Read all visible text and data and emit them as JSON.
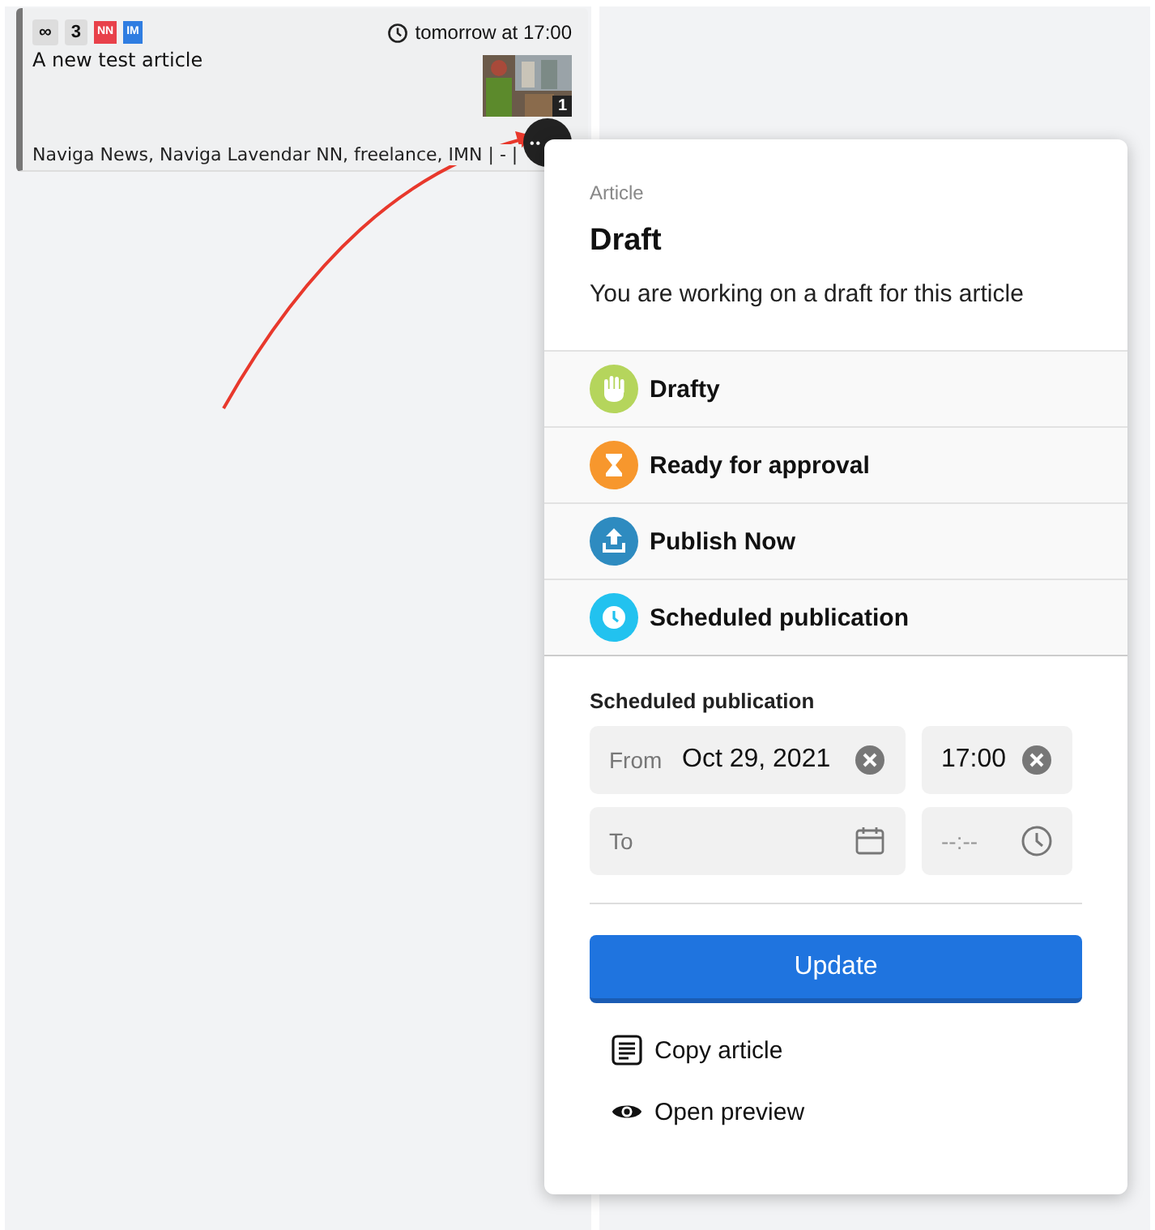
{
  "card": {
    "badges": [
      "∞",
      "3"
    ],
    "tags": [
      {
        "label": "NN",
        "color": "#e8414a"
      },
      {
        "label": "IM",
        "color": "#2f7de1"
      }
    ],
    "time": "tomorrow at 17:00",
    "title": "A new test article",
    "image_count": "1",
    "footer": "Naviga News, Naviga Lavendar NN, freelance, IMN | - |",
    "menu_button": "••"
  },
  "popup": {
    "kicker": "Article",
    "title": "Draft",
    "description": "You are working on a draft for this article",
    "statuses": [
      {
        "kind": "hand",
        "label": "Drafty",
        "color": "#b5d55c"
      },
      {
        "kind": "hourglass",
        "label": "Ready for approval",
        "color": "#f7972d"
      },
      {
        "kind": "upload",
        "label": "Publish Now",
        "color": "#2e8bc0"
      },
      {
        "kind": "clock",
        "label": "Scheduled publication",
        "color": "#22c2ef"
      }
    ],
    "schedule": {
      "heading": "Scheduled publication",
      "from": {
        "label": "From",
        "date": "Oct 29, 2021",
        "time": "17:00"
      },
      "to": {
        "label": "To",
        "time_placeholder": "--:--"
      }
    },
    "update_button": "Update",
    "actions": [
      {
        "kind": "copy",
        "label": "Copy article"
      },
      {
        "kind": "preview",
        "label": "Open preview"
      }
    ]
  }
}
